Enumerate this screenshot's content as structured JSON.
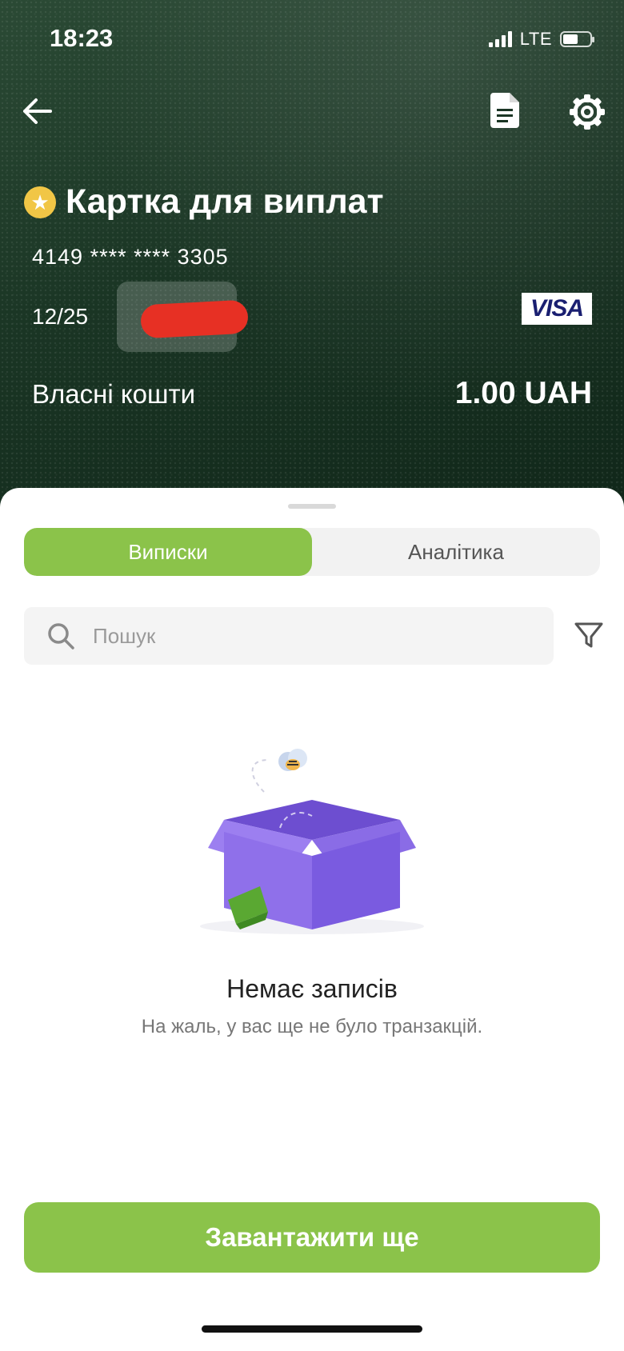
{
  "status_bar": {
    "time": "18:23",
    "network": "LTE"
  },
  "header": {
    "back_icon": "arrow-left-icon",
    "statement_icon": "document-icon",
    "settings_icon": "gear-icon"
  },
  "card": {
    "title": "Картка для виплат",
    "number": "4149 **** **** 3305",
    "expiry": "12/25",
    "brand": "VISA",
    "balance_label": "Власні кошти",
    "balance_value": "1.00 UAH",
    "star_icon": "star-icon"
  },
  "tabs": [
    {
      "label": "Виписки",
      "active": true
    },
    {
      "label": "Аналітика",
      "active": false
    }
  ],
  "search": {
    "placeholder": "Пошук",
    "value": ""
  },
  "empty_state": {
    "title": "Немає записів",
    "subtitle": "На жаль, у вас ще не було транзакцій."
  },
  "actions": {
    "load_more": "Завантажити ще"
  },
  "colors": {
    "accent": "#8bc34a",
    "header_bg": "#1a3524",
    "star": "#f1c646",
    "visa_blue": "#1a1f71"
  }
}
